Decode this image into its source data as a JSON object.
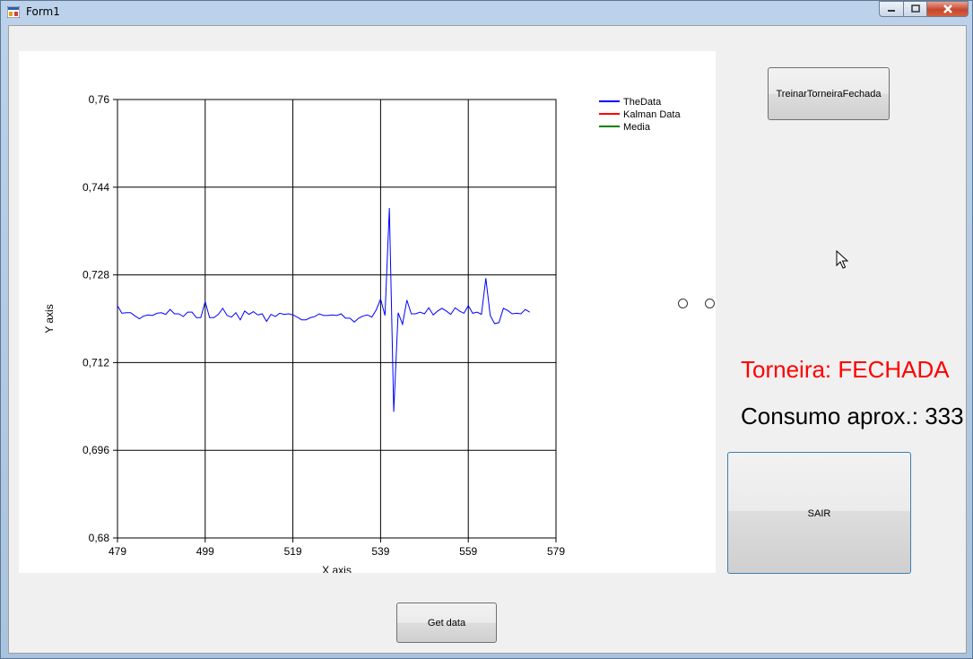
{
  "window": {
    "title": "Form1",
    "icon": "winforms-app-icon",
    "controls": [
      "minimize-icon",
      "maximize-icon",
      "close-icon"
    ]
  },
  "buttons": {
    "treinar_label": "TreinarTorneiraFechada",
    "sair_label": "SAIR",
    "getdata_label": "Get data"
  },
  "status": {
    "torneira_text": "Torneira: FECHADA",
    "torneira_color": "#ff0000",
    "consumo_text": "Consumo aprox.: 333"
  },
  "radio_options": [
    "",
    ""
  ],
  "chart_data": {
    "type": "line",
    "title": "",
    "xlabel": "X axis",
    "ylabel": "Y axis",
    "xlim": [
      479,
      579
    ],
    "ylim": [
      0.68,
      0.76
    ],
    "x_ticks": [
      "479",
      "499",
      "519",
      "539",
      "559",
      "579"
    ],
    "y_ticks": [
      "0,76",
      "0,744",
      "0,728",
      "0,712",
      "0,696",
      "0,68"
    ],
    "grid": true,
    "legend_position": "top-right",
    "series": [
      {
        "name": "TheData",
        "color": "#0000ff",
        "x_start": 479,
        "x_step": 1,
        "values": [
          0.7224,
          0.721,
          0.7211,
          0.7211,
          0.7205,
          0.72,
          0.7205,
          0.7207,
          0.7206,
          0.721,
          0.7211,
          0.7208,
          0.7217,
          0.7209,
          0.7209,
          0.7204,
          0.7212,
          0.7212,
          0.7202,
          0.7202,
          0.7231,
          0.7202,
          0.7202,
          0.7208,
          0.7219,
          0.7206,
          0.7203,
          0.7211,
          0.7198,
          0.7214,
          0.7208,
          0.7213,
          0.7207,
          0.7209,
          0.7195,
          0.7208,
          0.7204,
          0.721,
          0.7208,
          0.7209,
          0.7207,
          0.7203,
          0.7198,
          0.7198,
          0.7202,
          0.7204,
          0.7209,
          0.7206,
          0.7206,
          0.7207,
          0.7206,
          0.7209,
          0.7201,
          0.7201,
          0.7194,
          0.7201,
          0.7205,
          0.7207,
          0.7203,
          0.7216,
          0.7236,
          0.7206,
          0.7402,
          0.703,
          0.7211,
          0.719,
          0.7234,
          0.7209,
          0.7209,
          0.7212,
          0.7209,
          0.722,
          0.7207,
          0.7214,
          0.7219,
          0.7214,
          0.7208,
          0.722,
          0.7214,
          0.721,
          0.7224,
          0.721,
          0.7212,
          0.7208,
          0.7274,
          0.7206,
          0.7191,
          0.7193,
          0.7219,
          0.7215,
          0.7209,
          0.721,
          0.7209,
          0.7217,
          0.7212
        ]
      },
      {
        "name": "Kalman Data",
        "color": "#ff0000",
        "values": []
      },
      {
        "name": "Media",
        "color": "#008000",
        "values": []
      }
    ]
  }
}
